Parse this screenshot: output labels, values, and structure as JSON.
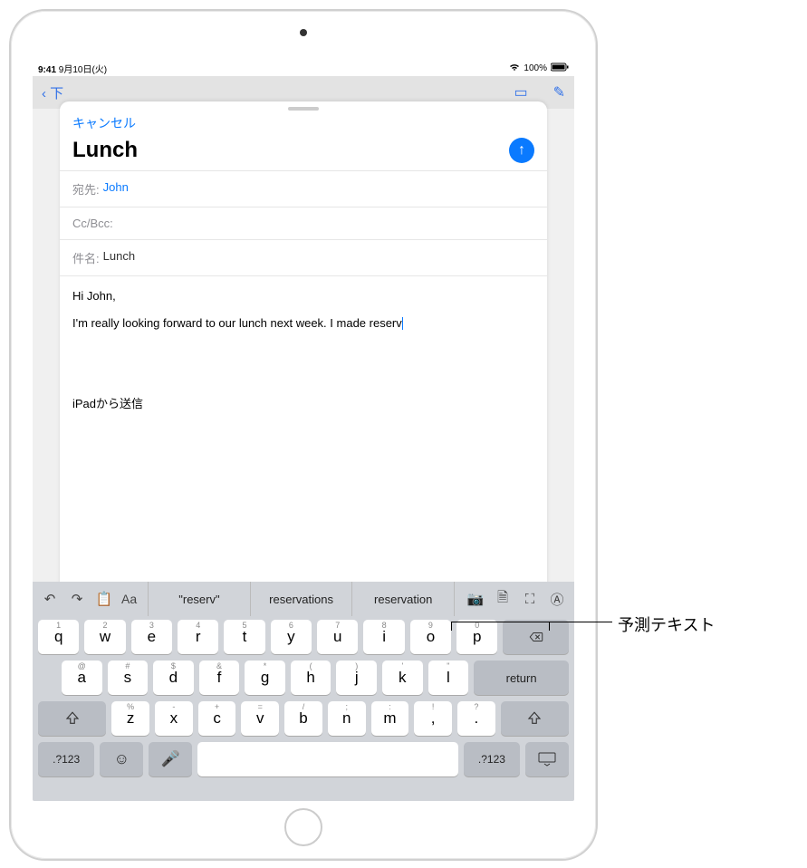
{
  "statusbar": {
    "time": "9:41",
    "date": "9月10日(火)",
    "wifi": "wifi-icon",
    "battery_pct": "100%"
  },
  "bg_nav": {
    "back": "下"
  },
  "compose": {
    "cancel": "キャンセル",
    "title": "Lunch",
    "to_label": "宛先:",
    "to_value": "John",
    "ccbcc_label": "Cc/Bcc:",
    "subject_label": "件名:",
    "subject_value": "Lunch",
    "body_line1": "Hi John,",
    "body_line2": "I'm really looking forward to our lunch next week. I made reserv",
    "signature": "iPadから送信"
  },
  "keyboard": {
    "predictions": [
      "\"reserv\"",
      "reservations",
      "reservation"
    ],
    "toolbar": {
      "format": "Aa"
    },
    "row1": [
      {
        "k": "q",
        "h": "1"
      },
      {
        "k": "w",
        "h": "2"
      },
      {
        "k": "e",
        "h": "3"
      },
      {
        "k": "r",
        "h": "4"
      },
      {
        "k": "t",
        "h": "5"
      },
      {
        "k": "y",
        "h": "6"
      },
      {
        "k": "u",
        "h": "7"
      },
      {
        "k": "i",
        "h": "8"
      },
      {
        "k": "o",
        "h": "9"
      },
      {
        "k": "p",
        "h": "0"
      }
    ],
    "row2": [
      {
        "k": "a",
        "h": "@"
      },
      {
        "k": "s",
        "h": "#"
      },
      {
        "k": "d",
        "h": "$"
      },
      {
        "k": "f",
        "h": "&"
      },
      {
        "k": "g",
        "h": "*"
      },
      {
        "k": "h",
        "h": "("
      },
      {
        "k": "j",
        "h": ")"
      },
      {
        "k": "k",
        "h": "'"
      },
      {
        "k": "l",
        "h": "\""
      }
    ],
    "row3": [
      {
        "k": "z",
        "h": "%"
      },
      {
        "k": "x",
        "h": "-"
      },
      {
        "k": "c",
        "h": "+"
      },
      {
        "k": "v",
        "h": "="
      },
      {
        "k": "b",
        "h": "/"
      },
      {
        "k": "n",
        "h": ";"
      },
      {
        "k": "m",
        "h": ":"
      },
      {
        "k": ",",
        "h": "!"
      },
      {
        "k": ".",
        "h": "?"
      }
    ],
    "return": "return",
    "numkey": ".?123"
  },
  "callout": {
    "label": "予測テキスト"
  }
}
